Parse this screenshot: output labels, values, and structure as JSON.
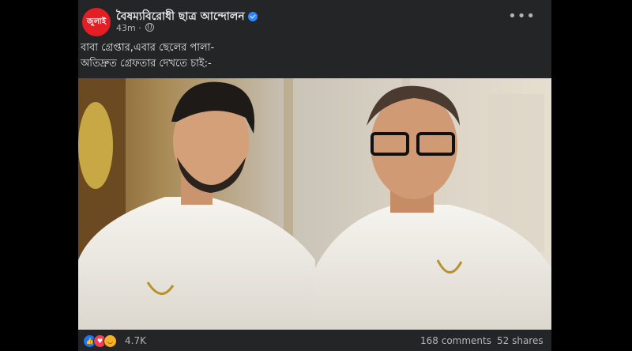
{
  "post": {
    "page_name": "বৈষম্যবিরোধী ছাত্র আন্দোলন",
    "avatar_text": "জুলাই",
    "time": "43m",
    "caption_lines": [
      "বাবা গ্রেপ্তার,এবার ছেলের পালা-",
      "অতিদ্রুত গ্রেফতার দেখতে চাই:-"
    ]
  },
  "footer": {
    "reaction_count": "4.7K",
    "comments": "168 comments",
    "shares": "52 shares"
  },
  "icons": [
    "verified-badge-icon",
    "globe-icon",
    "more-options-icon",
    "like-reaction-icon",
    "love-reaction-icon",
    "haha-reaction-icon"
  ],
  "colors": {
    "card_bg": "#242526",
    "verified": "#2d88ff",
    "avatar": "#e31e24",
    "like": "#1877f2",
    "love": "#f33e58"
  }
}
